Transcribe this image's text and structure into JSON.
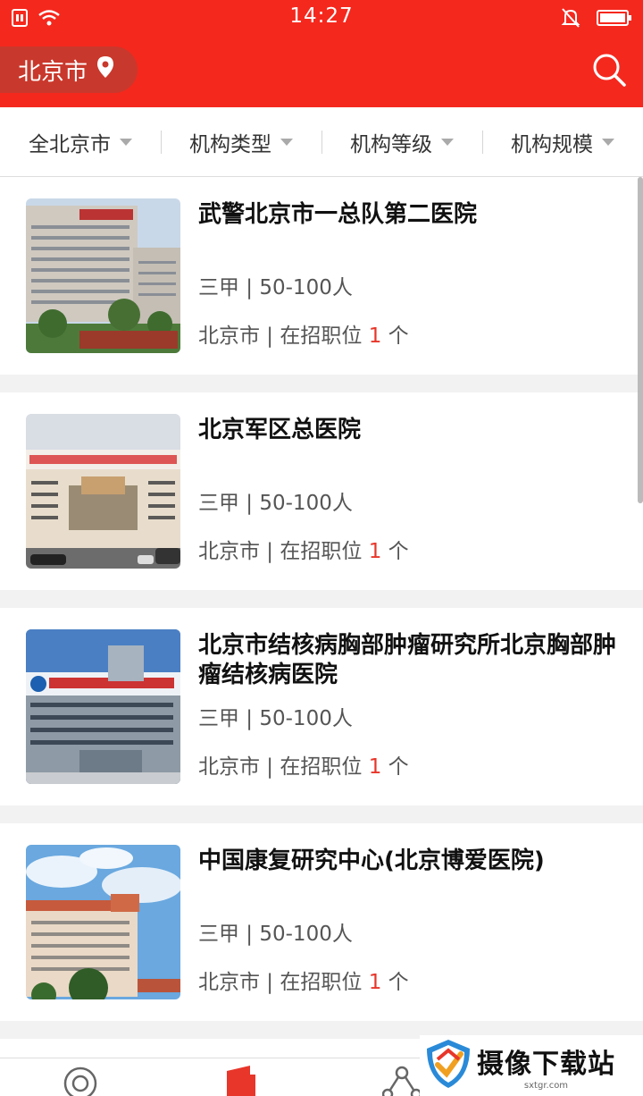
{
  "status_bar": {
    "time": "14:27"
  },
  "header": {
    "city": "北京市",
    "icons": [
      "location-pin-icon",
      "search-icon"
    ]
  },
  "filters": [
    {
      "label": "全北京市"
    },
    {
      "label": "机构类型"
    },
    {
      "label": "机构等级"
    },
    {
      "label": "机构规模"
    }
  ],
  "hospitals": [
    {
      "name": "武警北京市一总队第二医院",
      "meta": "三甲 | 50-100人",
      "loc_prefix": "北京市 | 在招职位 ",
      "positions": "1",
      "loc_suffix": " 个"
    },
    {
      "name": "北京军区总医院",
      "meta": "三甲 | 50-100人",
      "loc_prefix": "北京市 | 在招职位 ",
      "positions": "1",
      "loc_suffix": " 个"
    },
    {
      "name": "北京市结核病胸部肿瘤研究所北京胸部肿瘤结核病医院",
      "meta": "三甲 | 50-100人",
      "loc_prefix": "北京市 | 在招职位 ",
      "positions": "1",
      "loc_suffix": " 个"
    },
    {
      "name": "中国康复研究中心(北京博爱医院)",
      "meta": "三甲 | 50-100人",
      "loc_prefix": "北京市 | 在招职位 ",
      "positions": "1",
      "loc_suffix": " 个"
    }
  ],
  "tab_bar": {
    "icons": [
      "home-target-icon",
      "building-icon",
      "network-icon"
    ]
  },
  "watermark": {
    "main": "摄像下载站",
    "sub": "sxtgr.com"
  },
  "colors": {
    "brand": "#f5281e",
    "highlight": "#e8362a"
  }
}
